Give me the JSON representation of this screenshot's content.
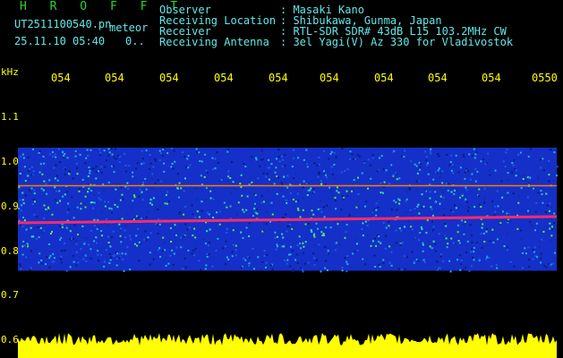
{
  "header": {
    "app_name": "H R O F F T",
    "filename": "UT2511100540.pn",
    "mode": "meteor",
    "datetime": "25.11.10 05:40",
    "count": "0..",
    "info_labels": [
      "Observer",
      "Receiving Location",
      "Receiver",
      "Receiving Antenna"
    ],
    "info_values": [
      ": Masaki Kano",
      ": Shibukawa, Gunma, Japan",
      ": RTL-SDR SDR# 43dB L15 103.2MHz CW",
      ": 3el Yagi(V) Az 330 for Vladivostok"
    ]
  },
  "axis": {
    "unit": "kHz",
    "time_ticks": [
      "054",
      "054",
      "054",
      "054",
      "054",
      "054",
      "054",
      "054",
      "054",
      "0550"
    ],
    "freq_ticks": [
      "1.1",
      "1.0",
      "0.9",
      "0.8",
      "0.7",
      "0.6"
    ]
  },
  "colors": {
    "background": "#000000",
    "label": "#ffff00",
    "title": "#2bd62b",
    "noise_band": "#1430c8",
    "signal_line": "#ff2a6a",
    "echo_line": "#ff7a00",
    "amplitude": "#ffff00"
  },
  "chart_data": {
    "type": "heatmap",
    "xlabel": "",
    "ylabel": "kHz",
    "x_ticks": [
      "054",
      "054",
      "054",
      "054",
      "054",
      "054",
      "054",
      "054",
      "054",
      "0550"
    ],
    "y_ticks": [
      1.1,
      1.0,
      0.9,
      0.8,
      0.7,
      0.6
    ],
    "ylim": [
      0.6,
      1.1
    ],
    "noise_band_khz": [
      0.755,
      1.03
    ],
    "signals": [
      {
        "freq_khz_start": 0.862,
        "freq_khz_end": 0.876,
        "color": "magenta"
      },
      {
        "freq_khz_start": 0.945,
        "freq_khz_end": 0.945,
        "color": "orange"
      }
    ],
    "grid": false
  }
}
